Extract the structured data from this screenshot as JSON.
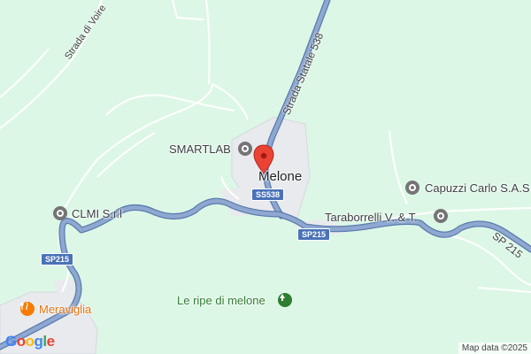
{
  "map": {
    "places": [
      {
        "name": "Melone",
        "kind": "locality"
      },
      {
        "name": "SMARTLAB",
        "kind": "place"
      },
      {
        "name": "CLMI S.r.l",
        "kind": "place"
      },
      {
        "name": "Capuzzi Carlo S.A.S",
        "kind": "place"
      },
      {
        "name": "Taraborrelli V. & T.",
        "kind": "place"
      },
      {
        "name": "Le ripe di melone",
        "kind": "park"
      },
      {
        "name": "Meraviglia",
        "kind": "restaurant"
      }
    ],
    "roads": [
      {
        "label": "Strada Statale 538"
      },
      {
        "label": "Strada di Voire"
      },
      {
        "label": "SP 215"
      }
    ],
    "shields": [
      "SS538",
      "SP215",
      "SP215"
    ],
    "logo": "Google",
    "attribution": "Map data ©2025",
    "colors": {
      "land": "#ddf7e6",
      "road": "#6f8fbf",
      "road_fill": "#8fa8d0",
      "urban": "#e8eaed",
      "pin": "#ea4335",
      "restaurant": "#f57c00",
      "park": "#2e7d32"
    },
    "icons": {
      "pin": "location-pin-icon",
      "place": "place-marker-icon",
      "restaurant": "restaurant-icon",
      "park": "park-icon"
    }
  }
}
